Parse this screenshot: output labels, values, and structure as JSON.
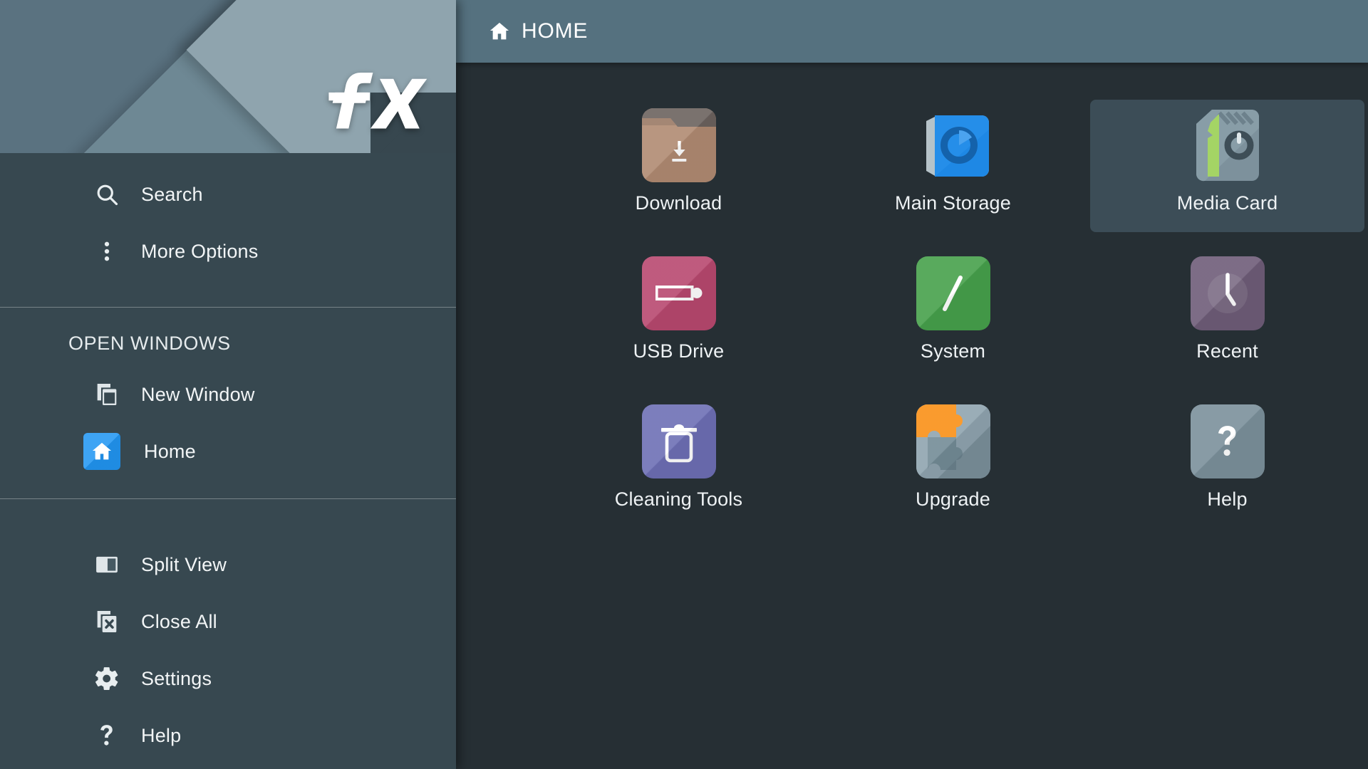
{
  "app": {
    "logo": "fx-logo",
    "accent_blue": "#2196f3",
    "sidebar_bg": "#37474f",
    "content_bg": "#263238",
    "topbar_bg": "#55717f",
    "selection_bg": "#3c4d57"
  },
  "sidebar": {
    "quick_actions": [
      {
        "label": "Search",
        "icon": "search-icon",
        "name": "sidebar-item-search"
      },
      {
        "label": "More Options",
        "icon": "more-vert-icon",
        "name": "sidebar-item-more-options"
      }
    ],
    "open_windows": {
      "title": "OPEN WINDOWS",
      "items": [
        {
          "label": "New Window",
          "icon": "new-window-icon",
          "name": "sidebar-item-new-window"
        },
        {
          "label": "Home",
          "icon": "home-icon",
          "name": "sidebar-item-home",
          "icon_color": "#2196f3"
        }
      ]
    },
    "tools": [
      {
        "label": "Split View",
        "icon": "split-view-icon",
        "name": "sidebar-item-split-view"
      },
      {
        "label": "Close All",
        "icon": "close-all-icon",
        "name": "sidebar-item-close-all"
      },
      {
        "label": "Settings",
        "icon": "gear-icon",
        "name": "sidebar-item-settings"
      },
      {
        "label": "Help",
        "icon": "question-mark-icon",
        "name": "sidebar-item-help"
      }
    ]
  },
  "topbar": {
    "breadcrumb": "HOME",
    "breadcrumb_icon": "home-icon"
  },
  "main": {
    "tiles": [
      {
        "label": "Download",
        "icon": "folder-download-icon",
        "color": "#b08a72",
        "selected": false
      },
      {
        "label": "Main Storage",
        "icon": "internal-storage-icon",
        "color": "#1e88e5",
        "selected": false
      },
      {
        "label": "Media Card",
        "icon": "sd-card-icon",
        "color": "#7b8f99",
        "selected": true
      },
      {
        "label": "USB Drive",
        "icon": "usb-drive-icon",
        "color": "#b8486f",
        "selected": false
      },
      {
        "label": "System",
        "icon": "root-slash-icon",
        "color": "#46a04b",
        "selected": false
      },
      {
        "label": "Recent",
        "icon": "clock-icon",
        "color": "#6e5c78",
        "selected": false
      },
      {
        "label": "Cleaning Tools",
        "icon": "trash-icon",
        "color": "#6d6fb5",
        "selected": false
      },
      {
        "label": "Upgrade",
        "icon": "puzzle-icon",
        "color": "#8fa4af",
        "selected": false
      },
      {
        "label": "Help",
        "icon": "question-mark-icon",
        "color": "#7b909b",
        "selected": false
      }
    ]
  }
}
